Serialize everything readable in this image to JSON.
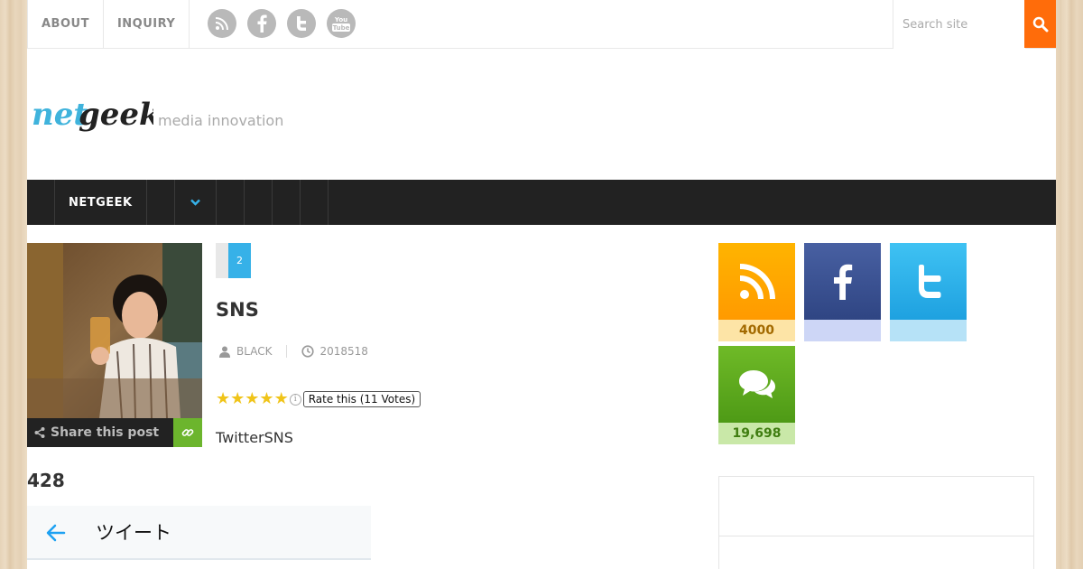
{
  "topbar": {
    "nav": [
      {
        "label": "ABOUT"
      },
      {
        "label": "INQUIRY"
      }
    ],
    "social_icons": [
      "rss-icon",
      "facebook-icon",
      "twitter-icon",
      "youtube-icon"
    ],
    "youtube_text": "You",
    "youtube_text2": "Tube",
    "search": {
      "placeholder": "Search site",
      "accent": "#ff6c0a"
    }
  },
  "header": {
    "logo_prefix": "net",
    "logo_suffix": "geek",
    "tagline": "media innovation"
  },
  "mainnav": {
    "items": [
      {
        "label": "NETGEEK"
      }
    ],
    "background": "#222222"
  },
  "post": {
    "category_count": "2",
    "title": "SNS",
    "author": "BLACK",
    "date": "2018518",
    "rating": {
      "stars": 5,
      "label": "Rate this (11 Votes)"
    },
    "share_label": "Share this post",
    "excerpt": "TwitterSNS",
    "count": "428",
    "tweet_header": "ツイート"
  },
  "sidebar": {
    "social": [
      {
        "name": "rss",
        "count": "4000"
      },
      {
        "name": "facebook",
        "count": ""
      },
      {
        "name": "twitter",
        "count": ""
      },
      {
        "name": "comments",
        "count": "19,698"
      }
    ]
  }
}
